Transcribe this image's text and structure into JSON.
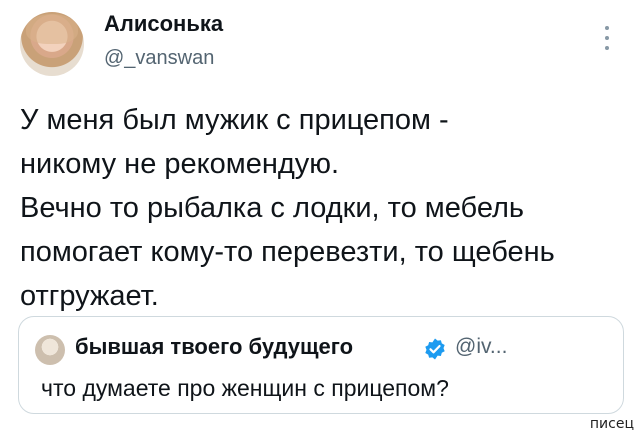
{
  "author": {
    "name": "Алисонька",
    "handle": "@_vanswan"
  },
  "tweet": {
    "lines": [
      "У меня был мужик с прицепом -",
      "никому не рекомендую.",
      "Вечно то рыбалка с лодки, то мебель",
      "помогает кому-то перевезти, то щебень",
      "отгружает."
    ]
  },
  "quoted": {
    "name": "бывшая твоего будущего",
    "handle": "@iv...",
    "text": "что думаете про женщин с прицепом?",
    "verified_color": "#1d9bf0"
  },
  "watermark": "писец",
  "icons": {
    "more": "more-vertical-icon",
    "verified": "verified-badge-icon"
  }
}
